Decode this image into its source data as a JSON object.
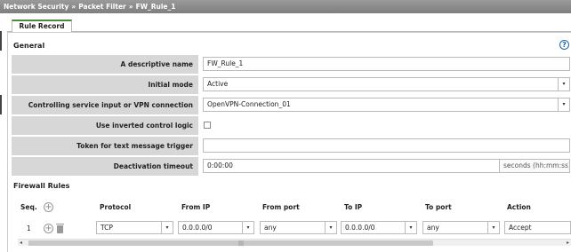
{
  "breadcrumb": [
    "Network Security",
    "Packet Filter",
    "FW_Rule_1"
  ],
  "breadcrumb_separator": "»",
  "tabs": [
    {
      "label": "Rule Record",
      "active": true
    }
  ],
  "general": {
    "title": "General",
    "help_icon": "?",
    "fields": {
      "description": {
        "label": "A descriptive name",
        "value": "FW_Rule_1"
      },
      "initial_mode": {
        "label": "Initial mode",
        "value": "Active"
      },
      "controlling": {
        "label": "Controlling service input or VPN connection",
        "value": "OpenVPN-Connection_01"
      },
      "inverted": {
        "label": "Use inverted control logic",
        "checked": false
      },
      "token": {
        "label": "Token for text message trigger",
        "value": ""
      },
      "timeout": {
        "label": "Deactivation timeout",
        "value": "0:00:00",
        "unit": "seconds (hh:mm:ss)"
      }
    }
  },
  "firewall_rules": {
    "title": "Firewall Rules",
    "columns": [
      "Seq.",
      "Protocol",
      "From IP",
      "From port",
      "To IP",
      "To port",
      "Action"
    ],
    "rows": [
      {
        "seq": "1",
        "protocol": "TCP",
        "from_ip": "0.0.0.0/0",
        "from_port": "any",
        "to_ip": "0.0.0.0/0",
        "to_port": "any",
        "action": "Accept"
      }
    ]
  },
  "icons": {
    "dropdown": "▾",
    "add": "+",
    "scroll_left": "◂",
    "scroll_right": "▸",
    "grip": "|||"
  },
  "colors": {
    "accent": "#4a8a3a",
    "help": "#1e63a8",
    "label_bg": "#d7d7d7",
    "header_bg": "#8c8c8c"
  }
}
